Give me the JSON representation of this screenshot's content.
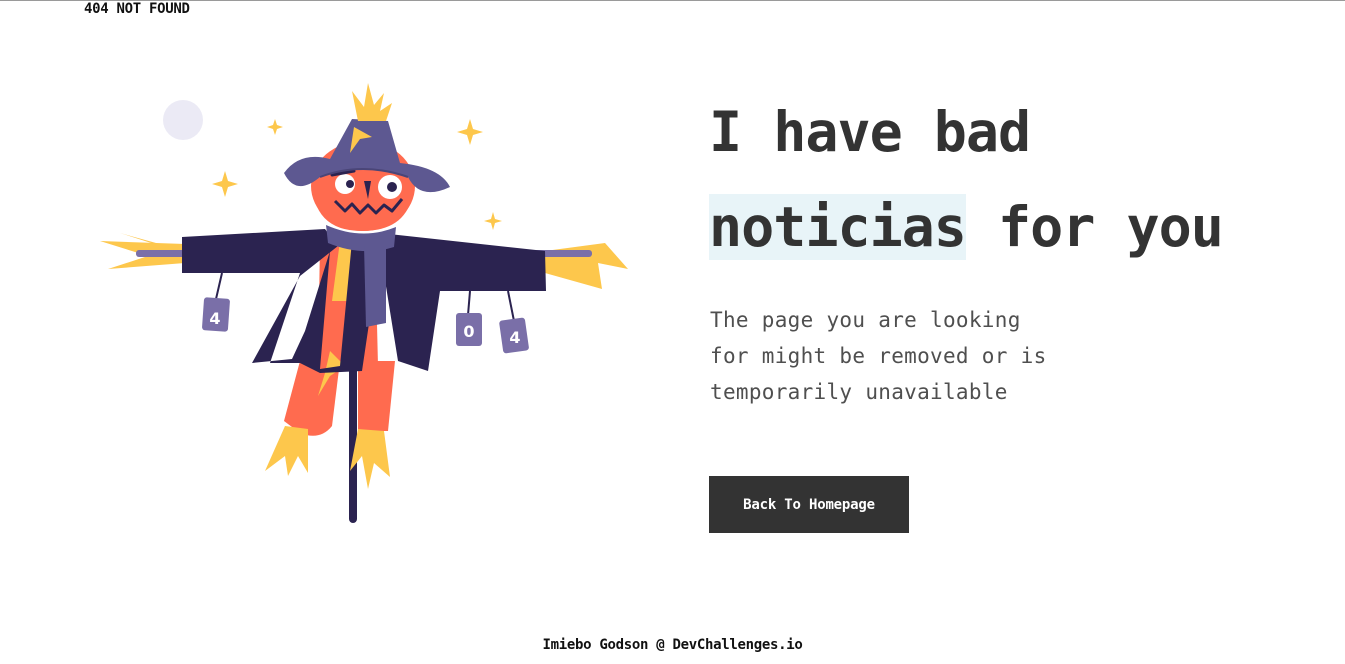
{
  "page": {
    "top_label": "404 NOT FOUND"
  },
  "headline": {
    "line1": "I have bad",
    "highlight": "noticias",
    "rest": " for you"
  },
  "description": "The page you are looking for might be removed or is temporarily unavailable",
  "button": {
    "label": "Back To Homepage"
  },
  "footer": {
    "credit": "Imiebo Godson @ DevChallenges.io"
  },
  "illustration": {
    "cans": [
      "4",
      "0",
      "4"
    ]
  },
  "colors": {
    "text_dark": "#333333",
    "highlight_bg": "#e8f4f8",
    "button_bg": "#333333",
    "hat": "#5d5891",
    "coat": "#2b2350",
    "face": "#ff6b4f",
    "straw": "#fdc74c",
    "moon": "#ebeaf5"
  }
}
